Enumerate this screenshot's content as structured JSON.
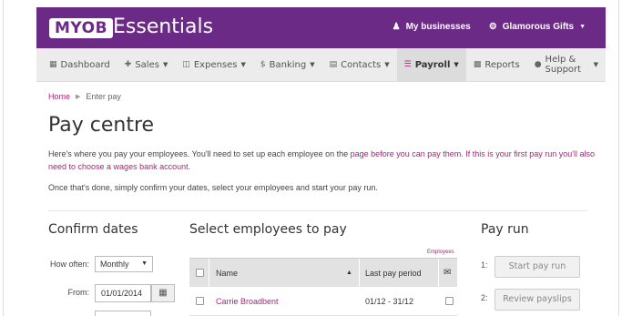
{
  "brand": {
    "logo": "MYOB",
    "product": "Essentials"
  },
  "topbar": {
    "my_businesses": "My businesses",
    "business_name": "Glamorous Gifts",
    "icons": [
      "user-icon",
      "gear-icon"
    ]
  },
  "nav": {
    "items": [
      {
        "label": "Dashboard",
        "icon": "dashboard-icon"
      },
      {
        "label": "Sales",
        "icon": "plus-icon"
      },
      {
        "label": "Expenses",
        "icon": "money-icon"
      },
      {
        "label": "Banking",
        "icon": "dollar-icon"
      },
      {
        "label": "Contacts",
        "icon": "book-icon"
      },
      {
        "label": "Payroll",
        "icon": "list-icon",
        "active": true
      },
      {
        "label": "Reports",
        "icon": "chart-icon"
      },
      {
        "label": "Help & Support",
        "icon": "chat-icon"
      }
    ]
  },
  "breadcrumb": {
    "home": "Home",
    "current": "Enter pay"
  },
  "page": {
    "title": "Pay centre",
    "intro_part1": "Here's where you pay your employees. You'll need to set up each employee on the ",
    "intro_link1": "page before you can pay them.",
    "intro_part2": " ",
    "intro_link2": "If this is your first pay run you'll also need to choose a wages bank account.",
    "intro2": "Once that's done, simply confirm your dates, select your employees and start your pay run."
  },
  "confirm_dates": {
    "title": "Confirm dates",
    "how_often_label": "How often:",
    "how_often_value": "Monthly",
    "from_label": "From:",
    "from_value": "01/01/2014"
  },
  "employees": {
    "title": "Select employees to pay",
    "small_label": "Employees",
    "columns": {
      "name": "Name",
      "last_pay_period": "Last pay period"
    },
    "rows": [
      {
        "name": "Carrie Broadbent",
        "last_pay_period": "01/12 - 31/12"
      }
    ]
  },
  "pay_run": {
    "title": "Pay run",
    "steps": [
      {
        "num": "1:",
        "label": "Start pay run"
      },
      {
        "num": "2:",
        "label": "Review payslips"
      }
    ]
  },
  "colors": {
    "brand_purple": "#6b2a86",
    "link_magenta": "#b0207a",
    "nav_bg": "#ececec"
  }
}
